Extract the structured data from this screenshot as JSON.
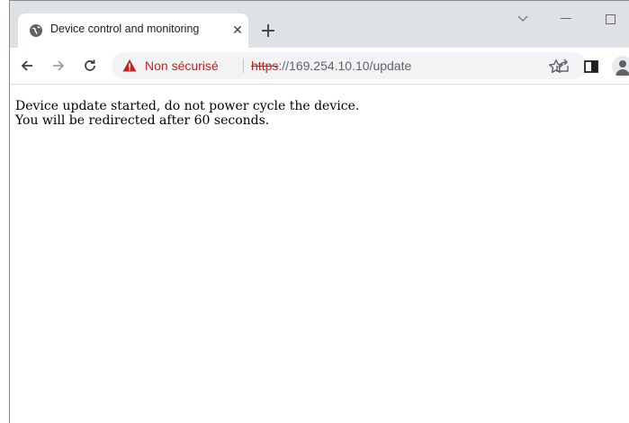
{
  "tab": {
    "title": "Device control and monitoring",
    "close_label": "✕",
    "new_tab_label": "+"
  },
  "window_controls": {
    "chevron": "⌵",
    "minimize": "—",
    "maximize": "☐"
  },
  "toolbar": {
    "back_icon": "back-arrow-icon",
    "forward_icon": "forward-arrow-icon",
    "reload_icon": "reload-icon"
  },
  "omnibox": {
    "security_label": "Non sécurisé",
    "url_scheme": "https",
    "url_rest": "://169.254.10.10/update"
  },
  "colors": {
    "tabstrip_bg": "#dee1e6",
    "warning_red": "#c5221f",
    "omnibox_bg": "#f1f3f4"
  },
  "page": {
    "line1": "Device update started, do not power cycle the device.",
    "line2": "You will be redirected after 60 seconds."
  }
}
